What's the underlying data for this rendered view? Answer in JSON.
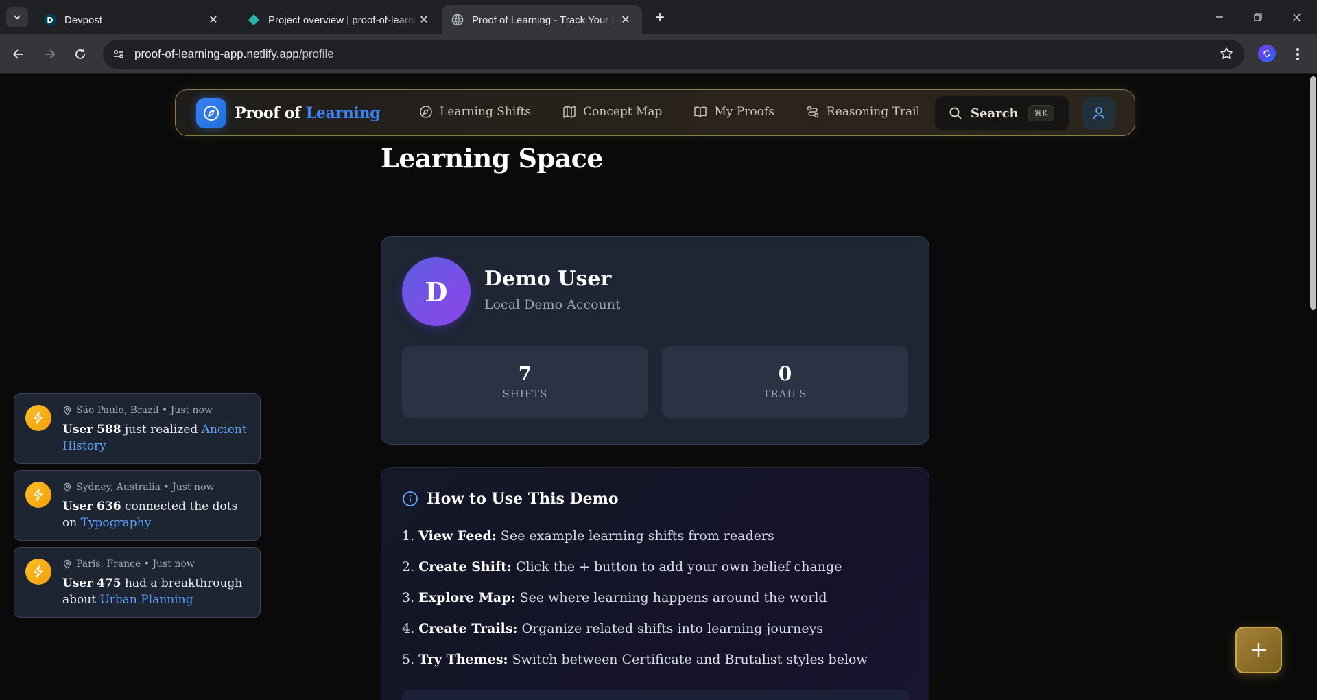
{
  "browser": {
    "tabs": [
      {
        "title": "Devpost",
        "favicon": "devpost-icon"
      },
      {
        "title": "Project overview | proof-of-learning",
        "favicon": "netlify-icon"
      },
      {
        "title": "Proof of Learning - Track Your Learning",
        "favicon": "globe-icon"
      }
    ],
    "url_host": "proof-of-learning-app.netlify.app",
    "url_path": "/profile"
  },
  "nav": {
    "brand_a": "Proof of",
    "brand_b": "Learning",
    "links": [
      "Learning Shifts",
      "Concept Map",
      "My Proofs",
      "Reasoning Trail"
    ],
    "search_label": "Search",
    "search_shortcut": "⌘K"
  },
  "page": {
    "title": "Learning Space"
  },
  "profile": {
    "initial": "D",
    "name": "Demo User",
    "subtitle": "Local Demo Account",
    "stats": [
      {
        "value": "7",
        "label": "SHIFTS"
      },
      {
        "value": "0",
        "label": "TRAILS"
      }
    ]
  },
  "howto": {
    "title": "How to Use This Demo",
    "steps": [
      {
        "num": "1.",
        "bold": "View Feed:",
        "text": "See example learning shifts from readers"
      },
      {
        "num": "2.",
        "bold": "Create Shift:",
        "text": "Click the + button to add your own belief change"
      },
      {
        "num": "3.",
        "bold": "Explore Map:",
        "text": "See where learning happens around the world"
      },
      {
        "num": "4.",
        "bold": "Create Trails:",
        "text": "Organize related shifts into learning journeys"
      },
      {
        "num": "5.",
        "bold": "Try Themes:",
        "text": "Switch between Certificate and Brutalist styles below"
      }
    ]
  },
  "activity": [
    {
      "location": "São Paulo, Brazil • Just now",
      "user": "User 588",
      "action": "just realized",
      "topic": "Ancient History"
    },
    {
      "location": "Sydney, Australia • Just now",
      "user": "User 636",
      "action": "connected the dots on",
      "topic": "Typography"
    },
    {
      "location": "Paris, France • Just now",
      "user": "User 475",
      "action": "had a breakthrough about",
      "topic": "Urban Planning"
    }
  ],
  "colors": {
    "accent_blue": "#3b82f6",
    "gold": "#c9a54c",
    "card_bg": "#1e2533",
    "page_bg": "#0a0a0a"
  }
}
